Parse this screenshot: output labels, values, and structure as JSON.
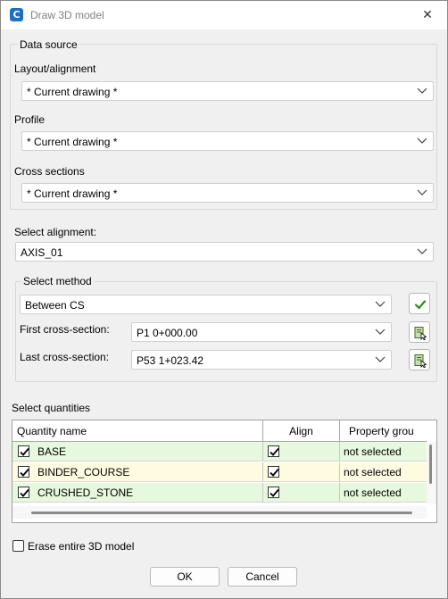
{
  "window": {
    "title": "Draw 3D model",
    "app_icon_letter": "C",
    "close_glyph": "✕"
  },
  "data_source": {
    "legend": "Data source",
    "layout_label": "Layout/alignment",
    "layout_value": "* Current drawing *",
    "profile_label": "Profile",
    "profile_value": "* Current drawing *",
    "cross_label": "Cross sections",
    "cross_value": "* Current drawing *"
  },
  "alignment": {
    "label": "Select alignment:",
    "value": "AXIS_01"
  },
  "method": {
    "legend": "Select method",
    "value": "Between CS",
    "first_label": "First cross-section:",
    "first_value": "P1 0+000.00",
    "last_label": "Last cross-section:",
    "last_value": "P53 1+023.42"
  },
  "quantities": {
    "label": "Select quantities",
    "columns": [
      "Quantity name",
      "Align",
      "Property grou"
    ],
    "rows": [
      {
        "name": "BASE",
        "checked": true,
        "align": true,
        "property": "not selected",
        "color": "#e6f8dd"
      },
      {
        "name": "BINDER_COURSE",
        "checked": true,
        "align": true,
        "property": "not selected",
        "color": "#fffbe0"
      },
      {
        "name": "CRUSHED_STONE",
        "checked": true,
        "align": true,
        "property": "not selected",
        "color": "#e6f8dd"
      }
    ]
  },
  "erase": {
    "label": "Erase entire 3D model",
    "checked": false
  },
  "buttons": {
    "ok": "OK",
    "cancel": "Cancel"
  },
  "colors": {
    "accent_check": "#2e8b1e",
    "app_icon": "#1f6fc9"
  }
}
